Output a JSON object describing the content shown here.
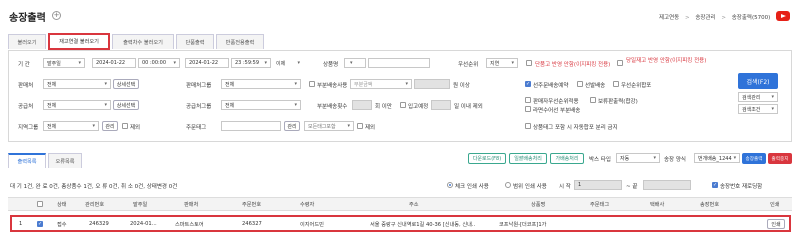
{
  "header": {
    "title": "송장출력",
    "breadcrumb": [
      "제고연동",
      "송장관리",
      "송장출력(5700)"
    ],
    "separator": ">"
  },
  "top_tabs": [
    "불러오기",
    "재고연결 불러오기",
    "출력차수 불러오기",
    "단품출력",
    "반품전용출력"
  ],
  "filters": {
    "period_label": "기 간",
    "period_type": "발주일",
    "date_from": "2024-01-22",
    "time_from": "00 :00:00",
    "date_to": "2024-01-22",
    "time_to": "23 :59:59",
    "period_unit": "이제",
    "product_label": "상품명",
    "priority_label": "우선순위",
    "priority_value": "지연",
    "option_single_stock": "단품고 반영 안함(이지피킹 전용)",
    "option_multi_stock": "당일재고 반영 안함(이지피킹 전용)",
    "seller_label": "판매처",
    "seller_value": "전체",
    "seller_detail": "상세선택",
    "seller_group_label": "판매처그룹",
    "seller_group_value": "전체",
    "partial_ship_label": "부분배송사용",
    "partial_qty_placeholder": "부분금액",
    "over_amount": "원 이상",
    "first_come_label": "선주문배송예약",
    "preorder_label": "선발배송",
    "priority_ship_label": "우선순위합포",
    "supplier_label": "공급처",
    "supplier_value": "전체",
    "supplier_detail": "상세선택",
    "supplier_group_label": "공급처그룹",
    "supplier_group_value": "전체",
    "partial_count_label": "부분배송횟수",
    "under_count": "회 이만",
    "stock_expected_label": "입고예정",
    "days_exclude": "일 이내 제외",
    "seller_sorted_label": "판매자우선순위적용",
    "check_hold_label": "보류판출력(합강)",
    "hand_price_label": "라면수어선 부분배송",
    "region_group_label": "지역그룹",
    "region_value": "전체",
    "manage_btn": "관리",
    "exclude_label": "제외",
    "order_tag_label": "주문태그",
    "tag_manage_btn": "관리",
    "all_tag_label": "모든태그포함",
    "tag_exclude_label": "제외",
    "product_split_label": "상품태그 포함 시 자동합포 분리 금지",
    "search_btn": "검색(F2)",
    "search_mgmt": "검색관리",
    "search_cond": "검색조건"
  },
  "list_tabs": [
    "출력목록",
    "오류목록"
  ],
  "toolbar": {
    "download_btn": "다운로드(F8)",
    "bulk_ship_btn": "일괄배송처리",
    "hold_btn": "가배송처리",
    "box_type_label": "박스 타입",
    "box_type_value": "자동",
    "invoice_type_label": "송장 양식",
    "invoice_type_value": "번개배송_1244",
    "print_btn": "송장출력",
    "stop_btn": "출력중지"
  },
  "summary": {
    "text": "대 기 1건, 완 료 0건, 총상품수 1건, 오 류 0건, 취 소 0건, 상태변경 0건",
    "print_check": "체크 인쇄 사용",
    "range_print": "범위 인쇄 사용",
    "start_label": "시 작",
    "start_value": "1",
    "end_label": "~ 끝",
    "end_value": "",
    "invoice_order_label": "송장번호 재로딩함"
  },
  "table": {
    "columns": [
      "",
      "",
      "상태",
      "관리번호",
      "발주일",
      "판매처",
      "주문번호",
      "수령자",
      "주소",
      "상품명",
      "주문태그",
      "택배사",
      "송장번호",
      "인쇄"
    ],
    "rows": [
      {
        "no": "1",
        "checked": true,
        "status": "접수",
        "manage_no": "246329",
        "order_date": "2024-01...",
        "seller": "스마트스토어",
        "order_no": "246327",
        "receiver": "이지어드민",
        "address": "서울 중랑구 신내역로1길 40-36 [신내동, 신내..",
        "product": "코프낙원-[더코프]1가",
        "tag": "",
        "courier": "",
        "invoice": "",
        "print_btn": "인쇄"
      }
    ]
  },
  "colors": {
    "accent_red": "#d9363e",
    "accent_blue": "#2f73d9",
    "accent_green": "#2b8f78",
    "youtube": "#e62117"
  },
  "icons": {
    "add": "plus-circle-icon",
    "youtube": "youtube-icon",
    "settings": "gear-icon"
  }
}
